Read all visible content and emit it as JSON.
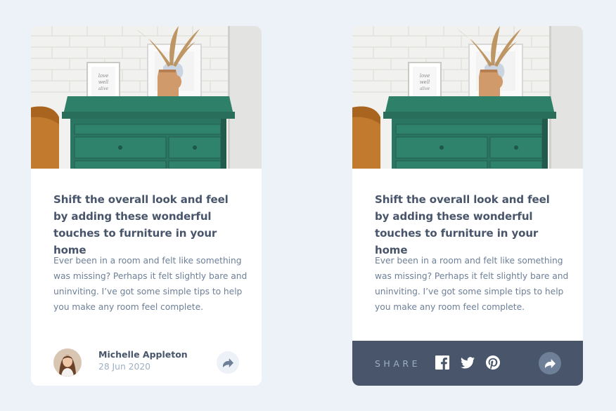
{
  "cards": [
    {
      "variant": "default",
      "title": "Shift the overall look and feel by adding these wonderful touches to furniture in your home",
      "description": "Ever been in a room and felt like something was missing? Perhaps it felt slightly bare and uninviting. I’ve got some simple tips to help you make any room feel complete.",
      "author": {
        "name": "Michelle Appleton",
        "date": "28 Jun 2020"
      },
      "share_icon": "share-arrow-icon"
    },
    {
      "variant": "share-active",
      "title": "Shift the overall look and feel by adding these wonderful touches to furniture in your home",
      "description": "Ever been in a room and felt like something was missing? Perhaps it felt slightly bare and uninviting. I’ve got some simple tips to help you make any room feel complete.",
      "share_bar": {
        "label": "SHARE",
        "icons": [
          "facebook-icon",
          "twitter-icon",
          "pinterest-icon"
        ]
      },
      "share_icon": "share-arrow-icon"
    }
  ],
  "colors": {
    "page_background": "#ecf2f8",
    "card_background": "#ffffff",
    "heading": "#48556a",
    "body_text": "#6e8098",
    "muted_text": "#9eafc2",
    "share_bar": "#48556a",
    "share_button_light": "#ecf2f8",
    "share_button_dark": "#6e8098",
    "dresser_green": "#2c7a66"
  }
}
